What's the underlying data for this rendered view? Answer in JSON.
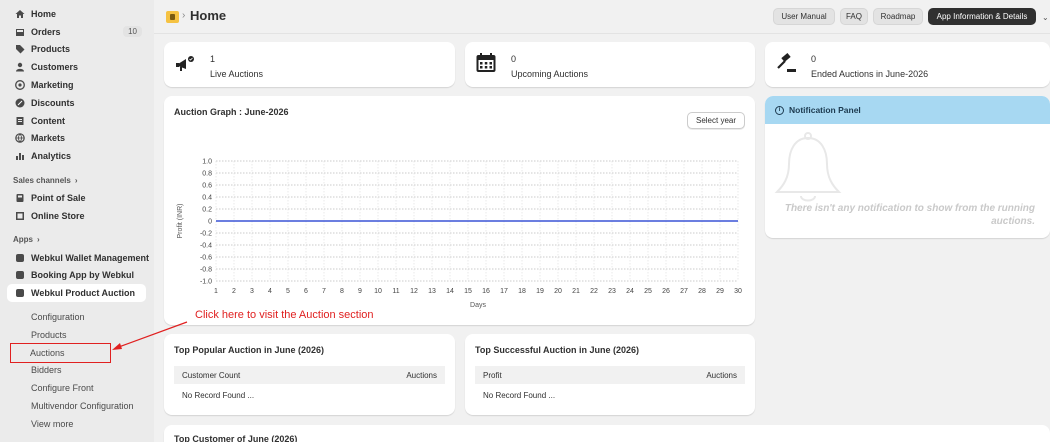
{
  "sidebar": {
    "items": [
      {
        "label": "Home",
        "icon": "home-icon"
      },
      {
        "label": "Orders",
        "icon": "orders-icon",
        "badge": "10"
      },
      {
        "label": "Products",
        "icon": "tag-icon"
      },
      {
        "label": "Customers",
        "icon": "person-icon"
      },
      {
        "label": "Marketing",
        "icon": "target-icon"
      },
      {
        "label": "Discounts",
        "icon": "discount-icon"
      },
      {
        "label": "Content",
        "icon": "content-icon"
      },
      {
        "label": "Markets",
        "icon": "globe-icon"
      },
      {
        "label": "Analytics",
        "icon": "bar-chart-icon"
      }
    ],
    "sales_channels_label": "Sales channels",
    "sales_channels": [
      {
        "label": "Point of Sale",
        "icon": "pos-icon"
      },
      {
        "label": "Online Store",
        "icon": "store-icon"
      }
    ],
    "apps_label": "Apps",
    "apps": [
      {
        "label": "Webkul Wallet Management"
      },
      {
        "label": "Booking App by Webkul"
      },
      {
        "label": "Webkul Product Auction"
      }
    ],
    "sub_items": [
      "Configuration",
      "Products",
      "Auctions",
      "Bidders",
      "Configure Front",
      "Multivendor Configuration",
      "View more"
    ]
  },
  "topbar": {
    "title": "Home",
    "buttons": [
      "User Manual",
      "FAQ",
      "Roadmap",
      "App Information & Details"
    ]
  },
  "stats": [
    {
      "value": "1",
      "label": "Live Auctions"
    },
    {
      "value": "0",
      "label": "Upcoming Auctions"
    },
    {
      "value": "0",
      "label": "Ended Auctions in June-2026"
    }
  ],
  "graph": {
    "title": "Auction Graph : June-2026",
    "select_label": "Select year"
  },
  "chart_data": {
    "type": "line",
    "x": [
      1,
      2,
      3,
      4,
      5,
      6,
      7,
      8,
      9,
      10,
      11,
      12,
      13,
      14,
      15,
      16,
      17,
      18,
      19,
      20,
      21,
      22,
      23,
      24,
      25,
      26,
      27,
      28,
      29,
      30
    ],
    "series": [
      {
        "values": [
          0,
          0,
          0,
          0,
          0,
          0,
          0,
          0,
          0,
          0,
          0,
          0,
          0,
          0,
          0,
          0,
          0,
          0,
          0,
          0,
          0,
          0,
          0,
          0,
          0,
          0,
          0,
          0,
          0,
          0
        ]
      }
    ],
    "yticks": [
      "1.0",
      "0.8",
      "0.6",
      "0.4",
      "0.2",
      "0",
      "-0.2",
      "-0.4",
      "-0.6",
      "-0.8",
      "-1.0"
    ],
    "ylim": [
      -1,
      1
    ],
    "xlabel": "Days",
    "ylabel": "Profit (INR)",
    "line_color": "#3a54d6",
    "grid": true
  },
  "notification": {
    "title": "Notification Panel",
    "message": "There isn't any notification to show from the running auctions."
  },
  "popular": {
    "title": "Top Popular Auction in June (2026)",
    "col1": "Customer Count",
    "col2": "Auctions",
    "empty": "No Record Found ..."
  },
  "successful": {
    "title": "Top Successful Auction in June (2026)",
    "col1": "Profit",
    "col2": "Auctions",
    "empty": "No Record Found ..."
  },
  "top_customer": {
    "title": "Top Customer of June (2026)"
  },
  "annotation": {
    "text": "Click here to visit the Auction section",
    "color": "#e02020"
  }
}
